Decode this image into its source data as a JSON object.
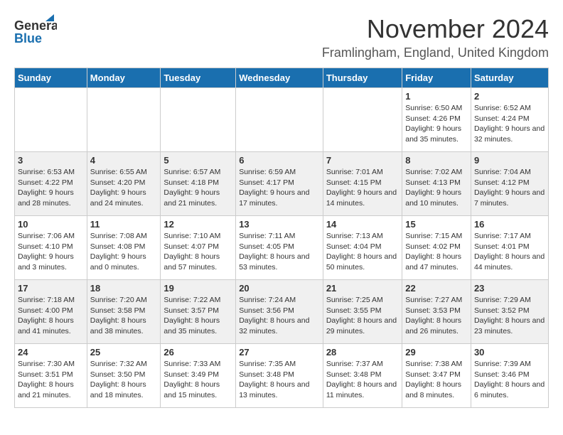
{
  "logo": {
    "line1": "General",
    "line2": "Blue"
  },
  "header": {
    "title": "November 2024",
    "subtitle": "Framlingham, England, United Kingdom"
  },
  "days_of_week": [
    "Sunday",
    "Monday",
    "Tuesday",
    "Wednesday",
    "Thursday",
    "Friday",
    "Saturday"
  ],
  "weeks": [
    [
      {
        "day": "",
        "info": ""
      },
      {
        "day": "",
        "info": ""
      },
      {
        "day": "",
        "info": ""
      },
      {
        "day": "",
        "info": ""
      },
      {
        "day": "",
        "info": ""
      },
      {
        "day": "1",
        "info": "Sunrise: 6:50 AM\nSunset: 4:26 PM\nDaylight: 9 hours and 35 minutes."
      },
      {
        "day": "2",
        "info": "Sunrise: 6:52 AM\nSunset: 4:24 PM\nDaylight: 9 hours and 32 minutes."
      }
    ],
    [
      {
        "day": "3",
        "info": "Sunrise: 6:53 AM\nSunset: 4:22 PM\nDaylight: 9 hours and 28 minutes."
      },
      {
        "day": "4",
        "info": "Sunrise: 6:55 AM\nSunset: 4:20 PM\nDaylight: 9 hours and 24 minutes."
      },
      {
        "day": "5",
        "info": "Sunrise: 6:57 AM\nSunset: 4:18 PM\nDaylight: 9 hours and 21 minutes."
      },
      {
        "day": "6",
        "info": "Sunrise: 6:59 AM\nSunset: 4:17 PM\nDaylight: 9 hours and 17 minutes."
      },
      {
        "day": "7",
        "info": "Sunrise: 7:01 AM\nSunset: 4:15 PM\nDaylight: 9 hours and 14 minutes."
      },
      {
        "day": "8",
        "info": "Sunrise: 7:02 AM\nSunset: 4:13 PM\nDaylight: 9 hours and 10 minutes."
      },
      {
        "day": "9",
        "info": "Sunrise: 7:04 AM\nSunset: 4:12 PM\nDaylight: 9 hours and 7 minutes."
      }
    ],
    [
      {
        "day": "10",
        "info": "Sunrise: 7:06 AM\nSunset: 4:10 PM\nDaylight: 9 hours and 3 minutes."
      },
      {
        "day": "11",
        "info": "Sunrise: 7:08 AM\nSunset: 4:08 PM\nDaylight: 9 hours and 0 minutes."
      },
      {
        "day": "12",
        "info": "Sunrise: 7:10 AM\nSunset: 4:07 PM\nDaylight: 8 hours and 57 minutes."
      },
      {
        "day": "13",
        "info": "Sunrise: 7:11 AM\nSunset: 4:05 PM\nDaylight: 8 hours and 53 minutes."
      },
      {
        "day": "14",
        "info": "Sunrise: 7:13 AM\nSunset: 4:04 PM\nDaylight: 8 hours and 50 minutes."
      },
      {
        "day": "15",
        "info": "Sunrise: 7:15 AM\nSunset: 4:02 PM\nDaylight: 8 hours and 47 minutes."
      },
      {
        "day": "16",
        "info": "Sunrise: 7:17 AM\nSunset: 4:01 PM\nDaylight: 8 hours and 44 minutes."
      }
    ],
    [
      {
        "day": "17",
        "info": "Sunrise: 7:18 AM\nSunset: 4:00 PM\nDaylight: 8 hours and 41 minutes."
      },
      {
        "day": "18",
        "info": "Sunrise: 7:20 AM\nSunset: 3:58 PM\nDaylight: 8 hours and 38 minutes."
      },
      {
        "day": "19",
        "info": "Sunrise: 7:22 AM\nSunset: 3:57 PM\nDaylight: 8 hours and 35 minutes."
      },
      {
        "day": "20",
        "info": "Sunrise: 7:24 AM\nSunset: 3:56 PM\nDaylight: 8 hours and 32 minutes."
      },
      {
        "day": "21",
        "info": "Sunrise: 7:25 AM\nSunset: 3:55 PM\nDaylight: 8 hours and 29 minutes."
      },
      {
        "day": "22",
        "info": "Sunrise: 7:27 AM\nSunset: 3:53 PM\nDaylight: 8 hours and 26 minutes."
      },
      {
        "day": "23",
        "info": "Sunrise: 7:29 AM\nSunset: 3:52 PM\nDaylight: 8 hours and 23 minutes."
      }
    ],
    [
      {
        "day": "24",
        "info": "Sunrise: 7:30 AM\nSunset: 3:51 PM\nDaylight: 8 hours and 21 minutes."
      },
      {
        "day": "25",
        "info": "Sunrise: 7:32 AM\nSunset: 3:50 PM\nDaylight: 8 hours and 18 minutes."
      },
      {
        "day": "26",
        "info": "Sunrise: 7:33 AM\nSunset: 3:49 PM\nDaylight: 8 hours and 15 minutes."
      },
      {
        "day": "27",
        "info": "Sunrise: 7:35 AM\nSunset: 3:48 PM\nDaylight: 8 hours and 13 minutes."
      },
      {
        "day": "28",
        "info": "Sunrise: 7:37 AM\nSunset: 3:48 PM\nDaylight: 8 hours and 11 minutes."
      },
      {
        "day": "29",
        "info": "Sunrise: 7:38 AM\nSunset: 3:47 PM\nDaylight: 8 hours and 8 minutes."
      },
      {
        "day": "30",
        "info": "Sunrise: 7:39 AM\nSunset: 3:46 PM\nDaylight: 8 hours and 6 minutes."
      }
    ]
  ]
}
